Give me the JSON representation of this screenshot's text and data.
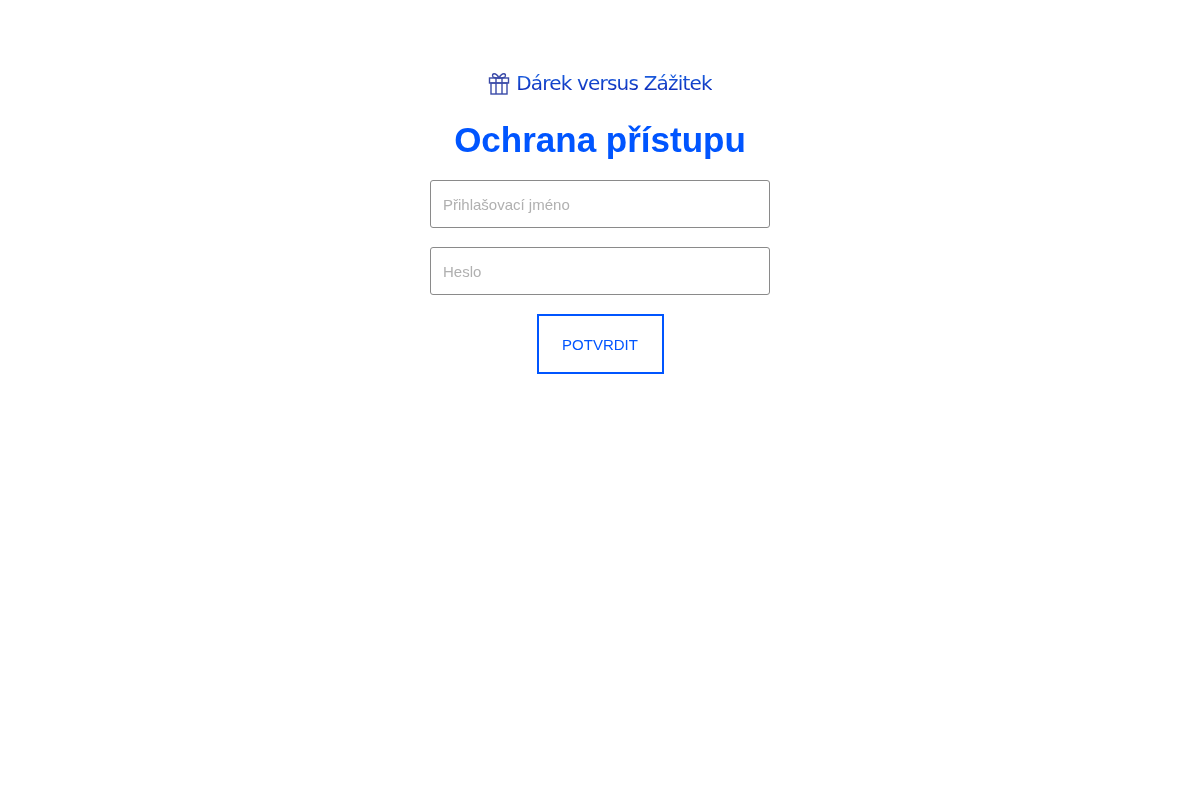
{
  "logo": {
    "text": "Dárek versus Zážitek"
  },
  "title": "Ochrana přístupu",
  "fields": [
    {
      "placeholder": "Přihlašovací jméno"
    },
    {
      "placeholder": "Heslo"
    }
  ],
  "submit": "POTVRDIT"
}
